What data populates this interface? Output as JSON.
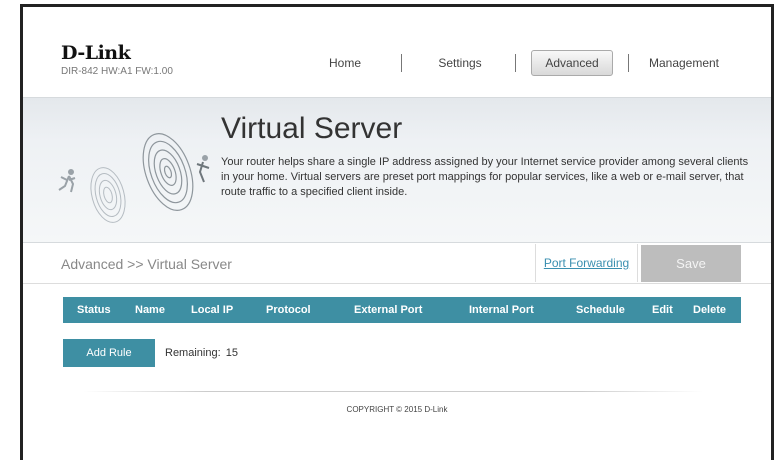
{
  "header": {
    "brand": "D-Link",
    "model_info": "DIR-842 HW:A1 FW:1.00",
    "nav": [
      {
        "label": "Home"
      },
      {
        "label": "Settings"
      },
      {
        "label": "Advanced",
        "active": true
      },
      {
        "label": "Management"
      }
    ]
  },
  "banner": {
    "title": "Virtual Server",
    "description": "Your router helps share a single IP address assigned by your Internet service provider among several clients in your home. Virtual servers are preset port mappings for popular services, like a web or e-mail server, that route traffic to a specified client inside."
  },
  "breadcrumb": "Advanced >> Virtual Server",
  "toolbar": {
    "port_forwarding_label": "Port Forwarding",
    "save_label": "Save"
  },
  "table": {
    "columns": [
      "Status",
      "Name",
      "Local IP",
      "Protocol",
      "External Port",
      "Internal Port",
      "Schedule",
      "Edit",
      "Delete"
    ],
    "rows": []
  },
  "rules": {
    "add_label": "Add Rule",
    "remaining_label": "Remaining:",
    "remaining_count": "15"
  },
  "footer": {
    "copyright": "COPYRIGHT © 2015 D-Link"
  },
  "colors": {
    "accent": "#3e8fa3",
    "save_disabled": "#bdbdbd",
    "link": "#3a8fb0"
  }
}
